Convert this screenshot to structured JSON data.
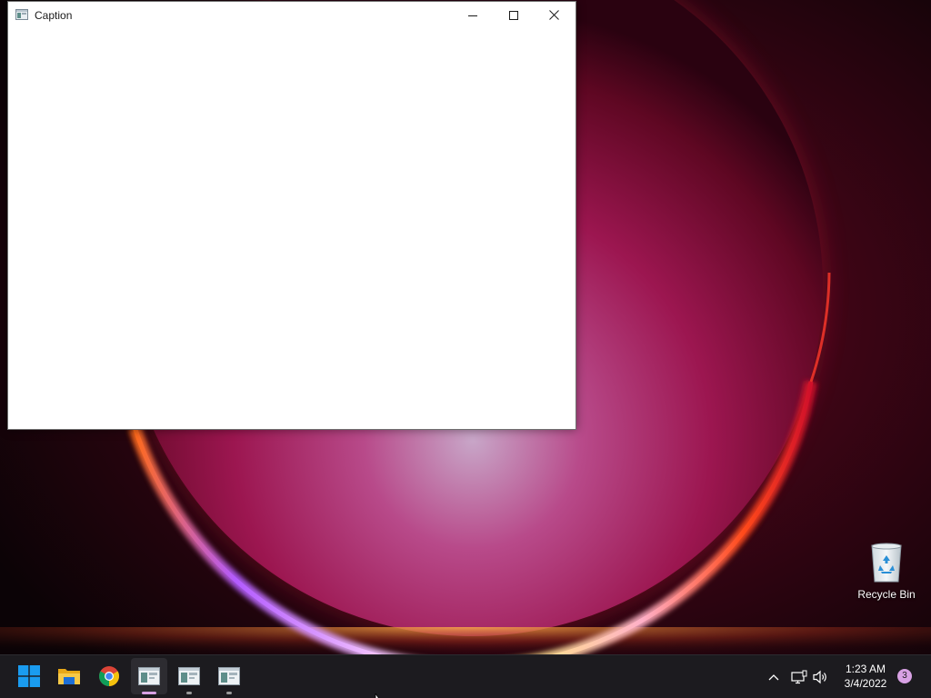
{
  "window": {
    "title": "Caption",
    "icon": "app-window-icon",
    "minimize_icon": "minimize-icon",
    "maximize_icon": "maximize-icon",
    "close_icon": "close-icon"
  },
  "desktop": {
    "icons": [
      {
        "label": "Recycle Bin",
        "icon": "recycle-bin-icon"
      }
    ]
  },
  "taskbar": {
    "apps": [
      {
        "name": "Start",
        "icon": "windows-start-icon",
        "running": false
      },
      {
        "name": "File Explorer",
        "icon": "folder-icon",
        "running": false
      },
      {
        "name": "Google Chrome",
        "icon": "chrome-icon",
        "running": false
      },
      {
        "name": "Caption",
        "icon": "app-window-icon",
        "running": true,
        "active": true
      },
      {
        "name": "App window 2",
        "icon": "app-window-icon",
        "running": true,
        "active": false
      },
      {
        "name": "App window 3",
        "icon": "app-window-icon",
        "running": true,
        "active": false
      }
    ],
    "tray": {
      "chevron_icon": "chevron-up-icon",
      "network_icon": "network-icon",
      "volume_icon": "volume-icon",
      "time": "1:23 AM",
      "date": "3/4/2022",
      "notification_count": "3"
    }
  },
  "colors": {
    "taskbar_bg": "#1c1b1f",
    "active_indicator": "#d8a1e4",
    "inactive_indicator": "#9a9a9a",
    "start_blue": "#1a9cf0"
  }
}
